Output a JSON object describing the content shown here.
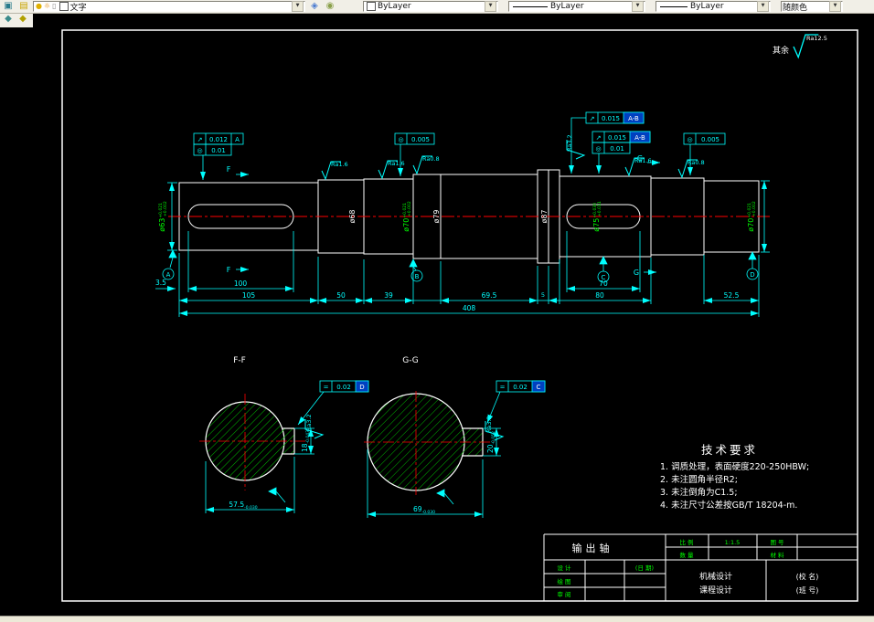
{
  "toolbar": {
    "layer_value": "文字",
    "color_value": "ByLayer",
    "linetype_value": "ByLayer",
    "lineweight_value": "ByLayer",
    "plotstyle_value": "随颜色"
  },
  "drawing": {
    "general_rough_prefix": "其余",
    "general_rough_value": "Ra12.5",
    "dims": {
      "n3_5": "3.5",
      "n100": "100",
      "n105": "105",
      "n50": "50",
      "n39": "39",
      "n69_5": "69.5",
      "n5": "5",
      "n80": "80",
      "n70": "70",
      "n52_5": "52.5",
      "n408": "408"
    },
    "dia": {
      "d63": "ø63",
      "d63t": "+0.021",
      "d63b": "+0.002",
      "d68": "ø68",
      "d70a": "ø70",
      "d70at": "+0.021",
      "d70ab": "+0.002",
      "d79": "ø79",
      "d87": "ø87",
      "d75": "ø75",
      "d75t": "+0.030",
      "d75b": "+0.011",
      "d70b": "ø70",
      "d70bt": "+0.021",
      "d70bb": "+0.002"
    },
    "frames": {
      "f1s": "↗",
      "f1v": "0.012",
      "f1r": "A",
      "f2s": "◎",
      "f2v": "0.01",
      "f3s": "◎",
      "f3v": "0.005",
      "f4s": "↗",
      "f4v": "0.015",
      "f4r": "A-B",
      "f5s": "↗",
      "f5v": "0.015",
      "f5r": "A-B",
      "f6s": "◎",
      "f6v": "0.01",
      "f7s": "◎",
      "f7v": "0.005",
      "f8s": "=",
      "f8v": "0.02",
      "f8r": "D",
      "f9s": "=",
      "f9v": "0.02",
      "f9r": "C"
    },
    "rough": {
      "r1": "Ra1.6",
      "r2": "Ra1.6",
      "r3": "Ra0.8",
      "r4": "Ra3.2",
      "r5": "Ra1.6",
      "r6": "Ra0.8",
      "ff": "Ra3.2",
      "gg": "Ra3.2"
    },
    "cuts": {
      "f": "F",
      "g": "G",
      "ff": "F-F",
      "gg": "G-G"
    },
    "datums": {
      "a": "A",
      "b": "B",
      "c": "C",
      "d": "D"
    },
    "sections": {
      "ff_w": "57.5",
      "ff_w_tol": "-0.030",
      "ff_d": "18",
      "ff_d_tol": "-0.043",
      "gg_w": "69",
      "gg_w_tol": "-0.030",
      "gg_d": "20",
      "gg_d_tol": "-0.052"
    },
    "tech": {
      "title": "技术要求",
      "l1": "1. 调质处理，表面硬度220-250HBW;",
      "l2": "2. 未注圆角半径R2;",
      "l3": "3. 未注倒角为C1.5;",
      "l4": "4. 未注尺寸公差按GB/T 18204-m."
    }
  },
  "title_block": {
    "part_name": "输出轴",
    "scale_label": "比 例",
    "scale_value": "1:1.5",
    "qty_label": "数 量",
    "dwg_label": "图 号",
    "mat_label": "材 料",
    "design_label": "设 计",
    "draft_label": "绘 图",
    "review_label": "审 阅",
    "date_label": "(日 期)",
    "org1": "机械设计",
    "org2": "课程设计",
    "school": "(校 名)",
    "class_no": "(班 号)"
  }
}
